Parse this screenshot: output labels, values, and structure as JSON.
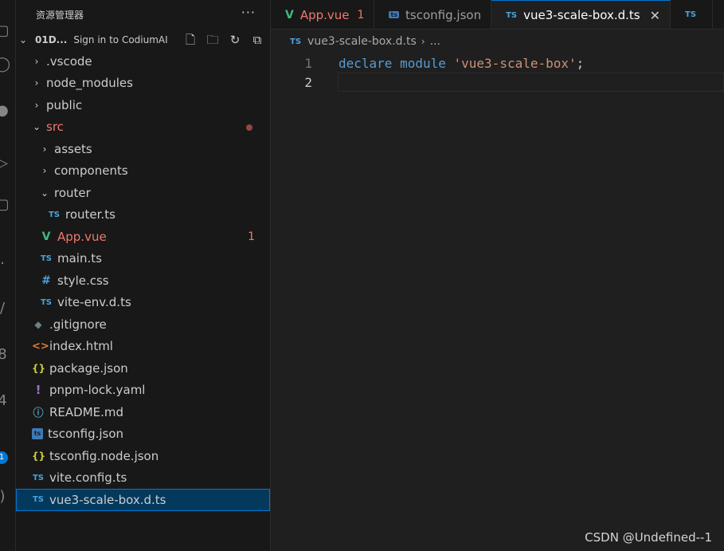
{
  "activity_bar": {
    "badge": "1"
  },
  "sidebar": {
    "title": "资源管理器",
    "more_icon": "ellipsis-icon",
    "project": {
      "name": "01D...",
      "signin": "Sign in to CodiumAI"
    },
    "tree": [
      {
        "label": ".vscode",
        "type": "folder",
        "expanded": false,
        "depth": 0
      },
      {
        "label": "node_modules",
        "type": "folder",
        "expanded": false,
        "depth": 0
      },
      {
        "label": "public",
        "type": "folder",
        "expanded": false,
        "depth": 0
      },
      {
        "label": "src",
        "type": "folder",
        "expanded": true,
        "depth": 0,
        "error": true
      },
      {
        "label": "assets",
        "type": "folder",
        "expanded": false,
        "depth": 1
      },
      {
        "label": "components",
        "type": "folder",
        "expanded": false,
        "depth": 1
      },
      {
        "label": "router",
        "type": "folder",
        "expanded": true,
        "depth": 1
      },
      {
        "label": "router.ts",
        "type": "ts",
        "depth": 2
      },
      {
        "label": "App.vue",
        "type": "vue",
        "depth": 1,
        "error": true,
        "count": "1"
      },
      {
        "label": "main.ts",
        "type": "ts",
        "depth": 1
      },
      {
        "label": "style.css",
        "type": "css",
        "depth": 1
      },
      {
        "label": "vite-env.d.ts",
        "type": "ts",
        "depth": 1
      },
      {
        "label": ".gitignore",
        "type": "git",
        "depth": 0
      },
      {
        "label": "index.html",
        "type": "html",
        "depth": 0
      },
      {
        "label": "package.json",
        "type": "json",
        "depth": 0
      },
      {
        "label": "pnpm-lock.yaml",
        "type": "yaml",
        "depth": 0
      },
      {
        "label": "README.md",
        "type": "info",
        "depth": 0
      },
      {
        "label": "tsconfig.json",
        "type": "tsconfig",
        "depth": 0
      },
      {
        "label": "tsconfig.node.json",
        "type": "json",
        "depth": 0
      },
      {
        "label": "vite.config.ts",
        "type": "ts",
        "depth": 0
      },
      {
        "label": "vue3-scale-box.d.ts",
        "type": "ts",
        "depth": 0,
        "selected": true
      }
    ]
  },
  "editor": {
    "tabs": [
      {
        "label": "App.vue",
        "type": "vue",
        "count": "1",
        "error": true
      },
      {
        "label": "tsconfig.json",
        "type": "tsconfig"
      },
      {
        "label": "vue3-scale-box.d.ts",
        "type": "ts",
        "active": true
      },
      {
        "label": "",
        "type": "ts"
      }
    ],
    "breadcrumb": {
      "file": "vue3-scale-box.d.ts",
      "rest": "..."
    },
    "lines": [
      {
        "num": "1",
        "tokens": [
          {
            "t": "declare",
            "c": "kw"
          },
          {
            "t": " ",
            "c": "punc"
          },
          {
            "t": "module",
            "c": "kw"
          },
          {
            "t": " ",
            "c": "punc"
          },
          {
            "t": "'vue3-scale-box'",
            "c": "str"
          },
          {
            "t": ";",
            "c": "punc"
          }
        ]
      },
      {
        "num": "2",
        "tokens": [],
        "current": true
      }
    ]
  },
  "icon_glyphs": {
    "ts": "TS",
    "vue": "V",
    "css": "#",
    "git": "◆",
    "html": "<>",
    "json": "{}",
    "yaml": "!",
    "info": "ⓘ",
    "tsconfig": "ts"
  },
  "watermark": "CSDN @Undefined--1"
}
